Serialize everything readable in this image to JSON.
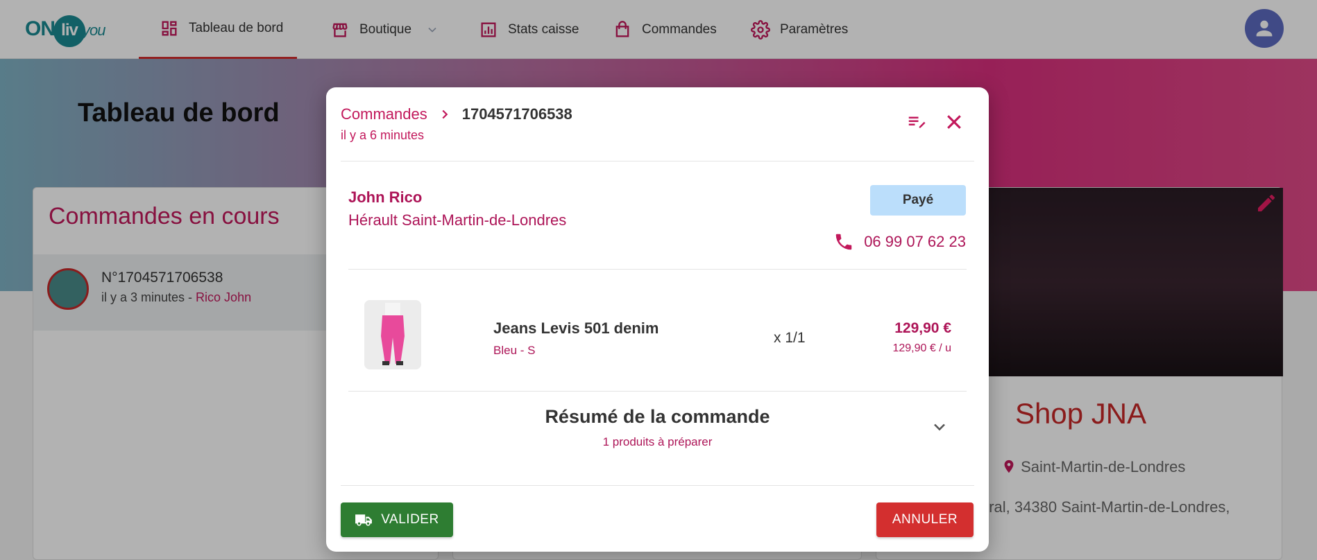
{
  "nav": {
    "logo_on": "ON",
    "logo_liv": "liv",
    "logo_you": "you",
    "items": [
      {
        "label": "Tableau de bord"
      },
      {
        "label": "Boutique"
      },
      {
        "label": "Stats caisse"
      },
      {
        "label": "Commandes"
      },
      {
        "label": "Paramètres"
      }
    ]
  },
  "page": {
    "title": "Tableau de bord"
  },
  "orders_card": {
    "title": "Commandes en cours",
    "row_number": "N°1704571706538",
    "row_time": "il y a 3 minutes - ",
    "row_customer": "Rico John"
  },
  "shop_card": {
    "name": "Shop JNA",
    "city": "Saint-Martin-de-Londres",
    "address": "oral, 34380 Saint-Martin-de-Londres,"
  },
  "modal": {
    "breadcrumb_link": "Commandes",
    "order_id": "1704571706538",
    "time_ago": "il y a 6 minutes",
    "customer_name": "John Rico",
    "customer_address": "Hérault Saint-Martin-de-Londres",
    "status": "Payé",
    "phone": "06 99 07 62 23",
    "product": {
      "name": "Jeans Levis 501 denim",
      "variant": "Bleu - S",
      "quantity": "x 1/1",
      "total": "129,90 €",
      "unit_price": "129,90 € / u"
    },
    "summary_title": "Résumé de la commande",
    "summary_subtitle": "1 produits à préparer",
    "validate_label": "VALIDER",
    "cancel_label": "ANNULER"
  },
  "colors": {
    "accent": "#c2185b",
    "validate": "#2e7d32",
    "cancel": "#d32f2f",
    "paid_badge": "#bbdefb"
  }
}
